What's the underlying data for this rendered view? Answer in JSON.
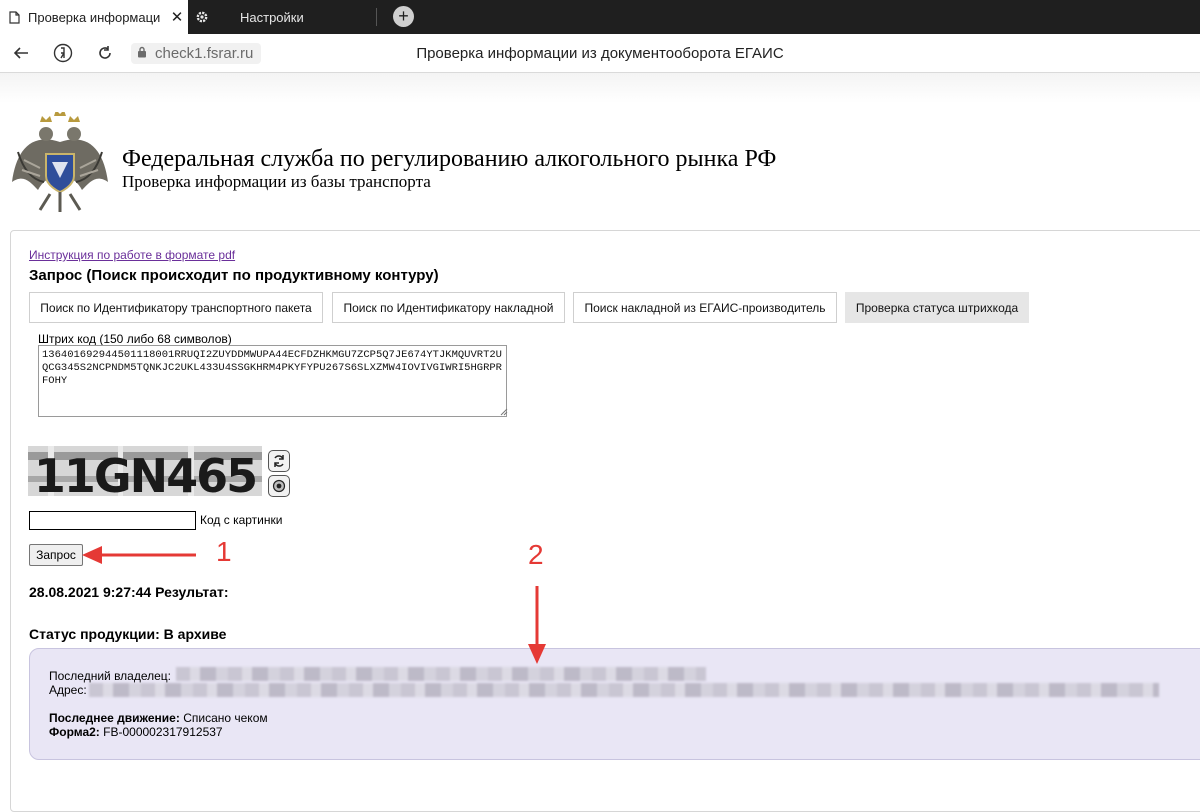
{
  "browser": {
    "active_tab_title": "Проверка информаци",
    "inactive_tab_title": "Настройки",
    "tab_close_glyph": "✕",
    "new_tab_glyph": "+",
    "address": "check1.fsrar.ru",
    "page_title": "Проверка информации из документооборота ЕГАИС"
  },
  "header": {
    "title": "Федеральная служба по регулированию алкогольного рынка РФ",
    "subtitle": "Проверка информации из базы транспорта"
  },
  "form": {
    "pdf_link": "Инструкция по работе в формате pdf",
    "request_title": "Запрос (Поиск происходит по продуктивному контуру)",
    "tabs": [
      {
        "label": "Поиск по Идентификатору транспортного пакета"
      },
      {
        "label": "Поиск по Идентификатору накладной"
      },
      {
        "label": "Поиск накладной из ЕГАИС-производитель"
      },
      {
        "label": "Проверка статуса штрихкода"
      }
    ],
    "barcode_label": "Штрих код (150 либо 68 символов)",
    "barcode_value": "136401692944501118001RRUQI2ZUYDDMWUPA44ECFDZHKMGU7ZCP5Q7JE674YTJKMQUVRT2UQCG345S2NCPNDM5TQNKJC2UKL433U4SSGKHRM4PKYFYPU267S6SLXZMW4IOVIVGIWRI5HGRPRFOHY",
    "captcha_text": "11GN465",
    "code_label": "Код с картинки",
    "submit_label": "Запрос"
  },
  "result": {
    "timestamp_line": "28.08.2021 9:27:44 Результат:",
    "status_line": "Статус продукции: В архиве",
    "owner_label": "Последний владелец:",
    "address_label": "Адрес:",
    "movement_label": "Последнее движение:",
    "movement_value": "Списано чеком",
    "form2_label": "Форма2:",
    "form2_value": "FB-000002317912537"
  },
  "annotations": {
    "arrow1_label": "1",
    "arrow2_label": "2",
    "color": "#e53935"
  }
}
